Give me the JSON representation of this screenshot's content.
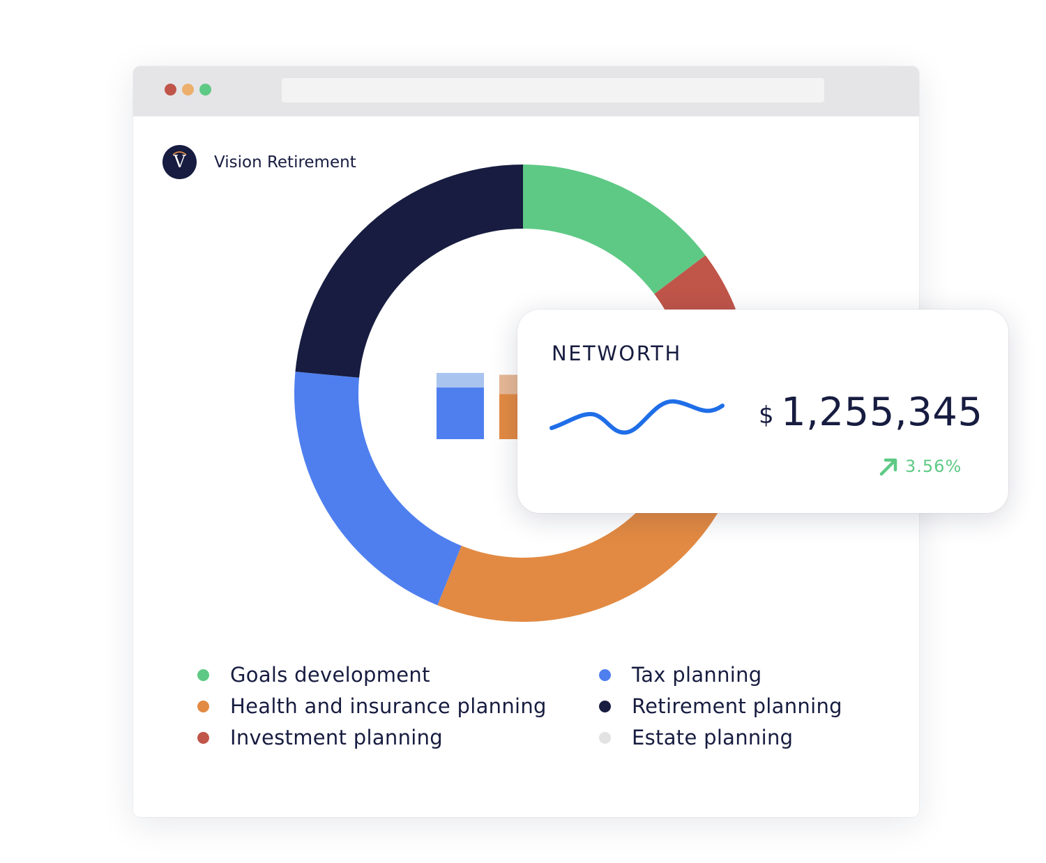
{
  "window": {
    "traffic_lights": [
      "#c0554a",
      "#ecb06c",
      "#5ec985"
    ]
  },
  "brand": {
    "logo_letter": "V",
    "name": "Vision Retirement"
  },
  "chart_data": {
    "type": "pie",
    "variant": "donut",
    "slices": [
      {
        "label": "Goals development",
        "value": 14.7,
        "color": "#5ec985"
      },
      {
        "label": "Investment planning",
        "value": 4.3,
        "color": "#c0554a"
      },
      {
        "label": "Estate planning",
        "value": 14.0,
        "color": "#e2e2e2"
      },
      {
        "label": "Health and insurance planning",
        "value": 23.1,
        "color": "#e28a43"
      },
      {
        "label": "Tax planning",
        "value": 20.4,
        "color": "#4f7fef"
      },
      {
        "label": "Retirement planning",
        "value": 23.5,
        "color": "#171c40"
      }
    ],
    "legend_placement": "bottom"
  },
  "legend": {
    "left": [
      {
        "label": "Goals development",
        "color": "#5ec985"
      },
      {
        "label": "Health and insurance planning",
        "color": "#e28a43"
      },
      {
        "label": "Investment planning",
        "color": "#c0554a"
      }
    ],
    "right": [
      {
        "label": "Tax planning",
        "color": "#4f7fef"
      },
      {
        "label": "Retirement planning",
        "color": "#171c40"
      },
      {
        "label": "Estate planning",
        "color": "#e2e2e2"
      }
    ]
  },
  "mini_bars": [
    {
      "value": 0.72,
      "highlight": 0.22,
      "color": "#4f7fef",
      "highlight_color": "#a9c4ef"
    },
    {
      "value": 0.7,
      "highlight": 0.3,
      "color": "#e28a43",
      "highlight_color": "#e6b896"
    }
  ],
  "networth": {
    "title": "NETWORTH",
    "currency": "$",
    "amount": "1,255,345",
    "change": "3.56%",
    "change_direction": "up",
    "sparkline_color": "#1f6ee8",
    "change_color": "#5ec985"
  }
}
